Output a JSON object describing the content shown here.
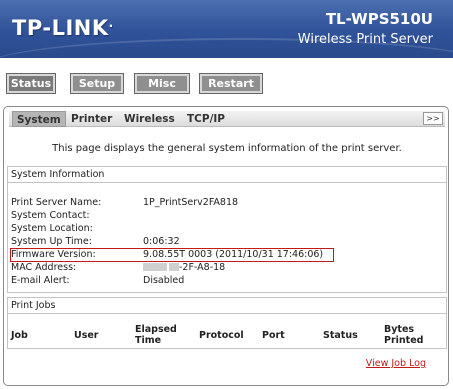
{
  "header": {
    "brand": "TP-LINK",
    "brand_suffix": ".",
    "model": "TL-WPS510U",
    "subtitle": "Wireless Print Server"
  },
  "topnav": {
    "status": "Status",
    "setup": "Setup",
    "misc": "Misc",
    "restart": "Restart"
  },
  "tabs": {
    "system": "System",
    "printer": "Printer",
    "wireless": "Wireless",
    "tcpip": "TCP/IP",
    "more": ">>"
  },
  "description": "This page displays the general system information of the print server.",
  "system_info": {
    "title": "System Information",
    "rows": [
      {
        "label": "Print Server Name:",
        "value": "1P_PrintServ2FA818"
      },
      {
        "label": "System Contact:",
        "value": ""
      },
      {
        "label": "System Location:",
        "value": ""
      },
      {
        "label": "System Up Time:",
        "value": "0:06:32"
      },
      {
        "label": "Firmware Version:",
        "value": "9.08.55T 0003 (2011/10/31 17:46:06)"
      },
      {
        "label": "MAC Address:",
        "value": "-2F-A8-18"
      },
      {
        "label": "E-mail Alert:",
        "value": "Disabled"
      }
    ]
  },
  "print_jobs": {
    "title": "Print Jobs",
    "columns": [
      "Job",
      "User",
      "Elapsed Time",
      "Protocol",
      "Port",
      "Status",
      "Bytes Printed"
    ],
    "elapsed_line1": "Elapsed",
    "elapsed_line2": "Time",
    "bytes_line1": "Bytes",
    "bytes_line2": "Printed",
    "view_log": "View Job Log"
  },
  "colors": {
    "banner": "#2f5299",
    "highlight": "#c21a1a",
    "button": "#8f8f8f"
  }
}
